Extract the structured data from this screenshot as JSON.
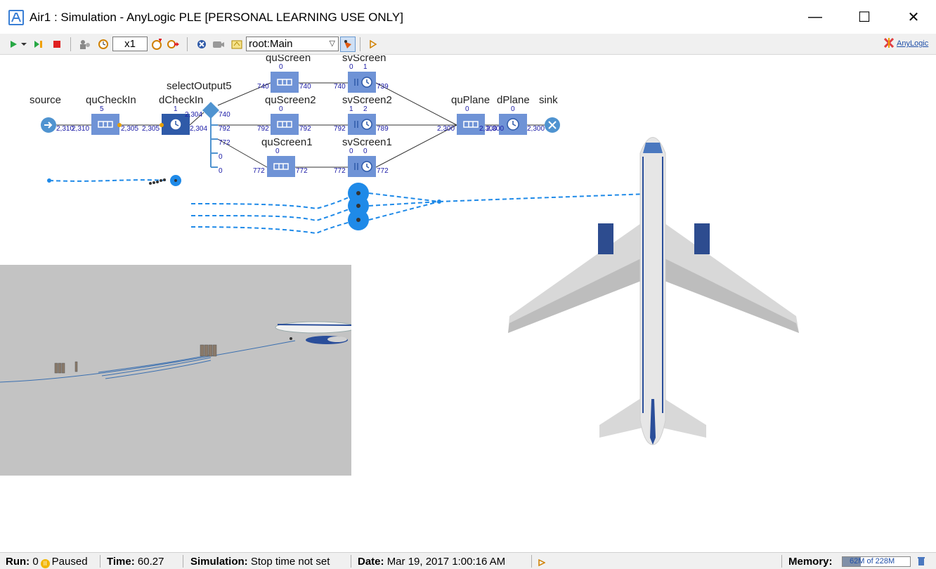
{
  "window": {
    "title": "Air1 : Simulation - AnyLogic PLE [PERSONAL LEARNING USE ONLY]",
    "minimize_glyph": "—",
    "maximize_glyph": "☐",
    "close_glyph": "✕"
  },
  "toolbar": {
    "speed": "x1",
    "view_selected": "root:Main",
    "brand": "AnyLogic",
    "icons": [
      "run-icon",
      "run-dropdown-icon",
      "step-icon",
      "stop-icon",
      "agent-icon",
      "clock-icon",
      "speed-display",
      "speed-up-icon",
      "fast-forward-icon",
      "navigate-icon",
      "camera-icon",
      "home-view-icon",
      "view-dropdown",
      "view-area-icon",
      "experiment-icon"
    ]
  },
  "model": {
    "blocks": {
      "source": "source",
      "quCheckIn": "quCheckIn",
      "dCheckIn": "dCheckIn",
      "selectOutput5": "selectOutput5",
      "quScreen": "quScreen",
      "svScreen": "svScreen",
      "quScreen2": "quScreen2",
      "svScreen2": "svScreen2",
      "quScreen1": "quScreen1",
      "svScreen1": "svScreen1",
      "quPlane": "quPlane",
      "dPlane": "dPlane",
      "sink": "sink"
    },
    "counts": {
      "quCheckIn_size": "5",
      "dCheckIn_size": "1",
      "source_out": "2,310",
      "quCheckIn_in": "2,310",
      "quCheckIn_out": "2,305",
      "dCheckIn_in": "2,305",
      "dCheckIn_out": "2,304",
      "select_in": "2,304",
      "select_out0": "740",
      "select_out1": "792",
      "select_out2": "772",
      "select_out3": "0",
      "select_out4": "0",
      "quScreen_size": "0",
      "quScreen_in": "740",
      "quScreen_out": "740",
      "svScreen_size_a": "0",
      "svScreen_size_b": "1",
      "svScreen_in": "740",
      "svScreen_out": "739",
      "quScreen2_size": "0",
      "quScreen2_in": "792",
      "quScreen2_out": "792",
      "svScreen2_size_a": "1",
      "svScreen2_size_b": "2",
      "svScreen2_in": "792",
      "svScreen2_out": "789",
      "quScreen1_size": "0",
      "quScreen1_in": "772",
      "quScreen1_out": "772",
      "svScreen1_size_a": "0",
      "svScreen1_size_b": "0",
      "svScreen1_in": "772",
      "svScreen1_out": "772",
      "quPlane_size": "0",
      "quPlane_in": "2,300",
      "quPlane_out": "2,300",
      "dPlane_size": "0",
      "dPlane_in": "2,300",
      "dPlane_out": "2,300"
    }
  },
  "colors": {
    "block_fill": "#6f93d6",
    "delay_fill": "#2f5aa8",
    "flow_blue": "#1f8ae8",
    "count_text": "#1a1aa6",
    "plane_body": "#e2e2e2",
    "plane_stripe": "#2a4e9a"
  },
  "status": {
    "run_label": "Run:",
    "run_value": "0",
    "state": "Paused",
    "time_label": "Time:",
    "time_value": "60.27",
    "simulation_label": "Simulation:",
    "simulation_value": "Stop time not set",
    "date_label": "Date:",
    "date_value": "Mar 19, 2017 1:00:16 AM",
    "memory_label": "Memory:",
    "memory_value": "62M of 228M",
    "memory_fraction": 0.27
  }
}
